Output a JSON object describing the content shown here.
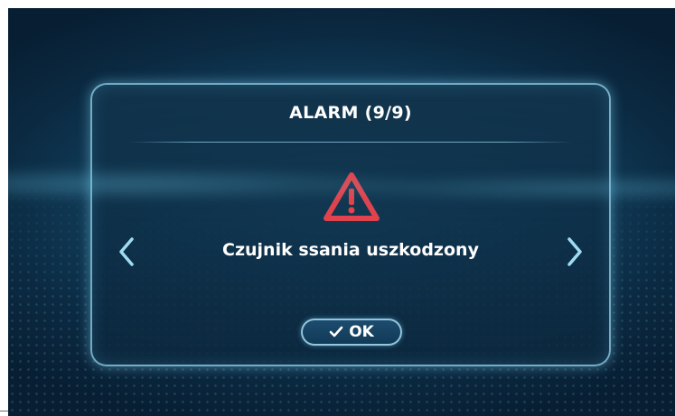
{
  "dialog": {
    "title": "ALARM (9/9)",
    "message": "Czujnik ssania uszkodzony",
    "ok_label": "OK"
  },
  "icons": {
    "warning": "warning-triangle-icon",
    "prev": "chevron-left-icon",
    "next": "chevron-right-icon",
    "ok": "checkmark-icon"
  },
  "colors": {
    "warning": "#e0434d",
    "accent": "#96d7f0",
    "background": "#0b2a42",
    "text": "#ffffff"
  }
}
